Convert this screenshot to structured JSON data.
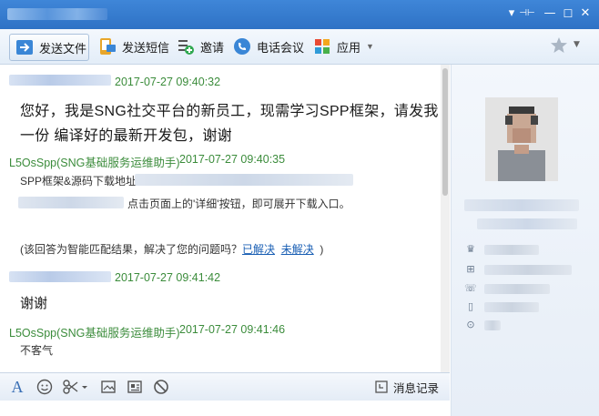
{
  "window": {
    "controls": [
      "▾",
      "⊣⊢",
      "—",
      "☐",
      "✕"
    ]
  },
  "toolbar": {
    "send_file": "发送文件",
    "send_sms": "发送短信",
    "invite": "邀请",
    "phone_meeting": "电话会议",
    "apps": "应用"
  },
  "messages": [
    {
      "sender": "",
      "time": "2017-07-27 09:40:32",
      "line1": "您好，我是SNG社交平台的新员工，现需学习SPP框架，请发我",
      "line2": "一份 编译好的最新开发包，谢谢"
    },
    {
      "sender": "L5OsSpp(SNG基础服务运维助手)",
      "time": "2017-07-27 09:40:35",
      "line1": "SPP框架&源码下载地址",
      "line2": "点击页面上的'详细'按钮，即可展开下载入口。",
      "prompt": "(该回答为智能匹配结果，解决了您的问题吗？",
      "solved": "已解决",
      "unsolved": "未解决",
      "close": ")"
    },
    {
      "sender": "",
      "time": "2017-07-27 09:41:42",
      "line1": "谢谢"
    },
    {
      "sender": "L5OsSpp(SNG基础服务运维助手)",
      "time": "2017-07-27 09:41:46",
      "line1": "不客气"
    }
  ],
  "input_toolbar": {
    "history": "消息记录",
    "icons": [
      "font-icon",
      "emoji-icon",
      "scissors-icon",
      "screenshot-icon",
      "image-icon",
      "block-icon"
    ]
  },
  "colors": {
    "title_bar": "#2e72c5",
    "own_time": "#3b8c3b",
    "bot_name": "#3b8c3b",
    "link": "#1a5fb4"
  }
}
